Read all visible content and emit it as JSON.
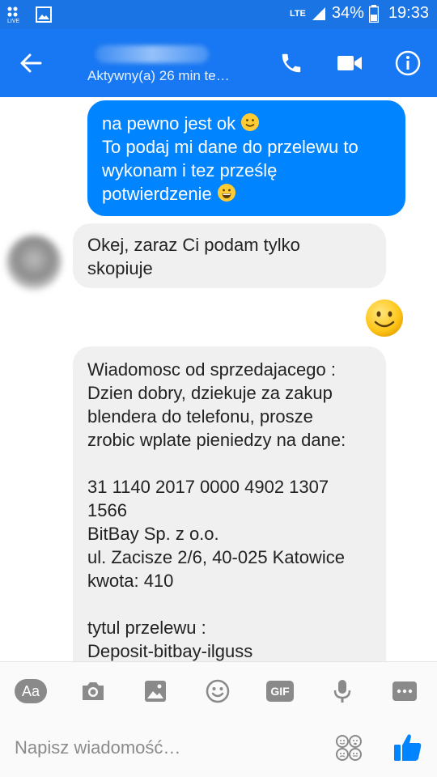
{
  "status_bar": {
    "network": "LTE",
    "battery": "34%",
    "time": "19:33"
  },
  "header": {
    "subtitle": "Aktywny(a) 26 min te…",
    "icons": [
      "back-arrow-icon",
      "phone-icon",
      "video-camera-icon",
      "info-icon"
    ]
  },
  "messages": [
    {
      "side": "out",
      "text": "na pewno jest ok",
      "emoji": "slight-smile-emoji"
    },
    {
      "side": "out",
      "text": "To podaj mi dane do przelewu to\nwykonam i tez prześlę\npotwierdzenie",
      "emoji": "grin-emoji"
    },
    {
      "side": "in",
      "text": "Okej, zaraz Ci podam tylko\nskopiuje"
    },
    {
      "side": "out",
      "emoji": "smile-emoji"
    },
    {
      "side": "in",
      "text": "Wiadomosc od sprzedajacego :\nDzien dobry, dziekuje za zakup\nblendera do telefonu, prosze\nzrobic wplate pieniedzy na dane:\n\n31 1140 2017 0000 4902 1307\n1566\nBitBay Sp. z o.o.\nul. Zacisze 2/6, 40-025 Katowice\nkwota: 410\n\ntytul przelewu :\nDeposit-bitbay-ilguss"
    }
  ],
  "composer": {
    "aa_label": "Aa",
    "gif_label": "GIF",
    "placeholder": "Napisz wiadomość…",
    "icons": [
      "text-style-icon",
      "camera-icon",
      "image-icon",
      "emoji-icon",
      "gif-icon",
      "microphone-icon",
      "more-icon",
      "reactions-icon",
      "like-icon"
    ]
  },
  "colors": {
    "header_blue": "#1877f2",
    "bubble_out": "#0084ff",
    "bubble_in": "#f0f0f0",
    "like_blue": "#0084ff"
  }
}
